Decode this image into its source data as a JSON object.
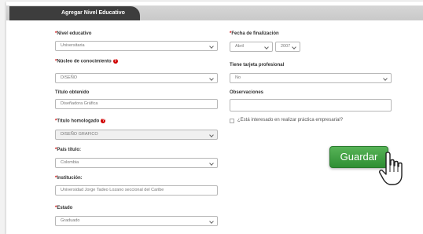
{
  "header": {
    "title": "Agregar Nivel Educativo"
  },
  "fields": {
    "nivel_educativo": {
      "label": "Nivel educativo",
      "value": "Universitaria"
    },
    "nucleo": {
      "label": "Núcleo de conocimiento",
      "value": "DISEÑO"
    },
    "titulo_obtenido": {
      "label": "Título obtenido",
      "value": "Diseñadora Gráfica"
    },
    "titulo_homologado": {
      "label": "Título homologado",
      "value": "DISEÑO GRAFICO"
    },
    "pais_titulo": {
      "label": "País título:",
      "value": "Colombia"
    },
    "institucion": {
      "label": "Institución:",
      "value": "Universidad Jorge Tadeo Lozano seccional del Caribe"
    },
    "estado": {
      "label": "Estado",
      "value": "Graduado"
    },
    "fecha_finalizacion": {
      "label": "Fecha de finalización",
      "month": "Abril",
      "year": "2007"
    },
    "tarjeta_profesional": {
      "label": "Tiene tarjeta profesional",
      "value": "No"
    },
    "observaciones": {
      "label": "Observaciones",
      "value": ""
    },
    "practica": {
      "label": "¿Está interesado en realizar práctica empresarial?"
    }
  },
  "required_mark": "*",
  "help_icon": "?",
  "buttons": {
    "guardar": "Guardar"
  },
  "icons": {
    "cursor": "hand-pointer-icon",
    "help": "question-circle-icon"
  },
  "colors": {
    "header_tab": "#3d3d3d",
    "required": "#d00000",
    "button": "#3a9b3e"
  }
}
